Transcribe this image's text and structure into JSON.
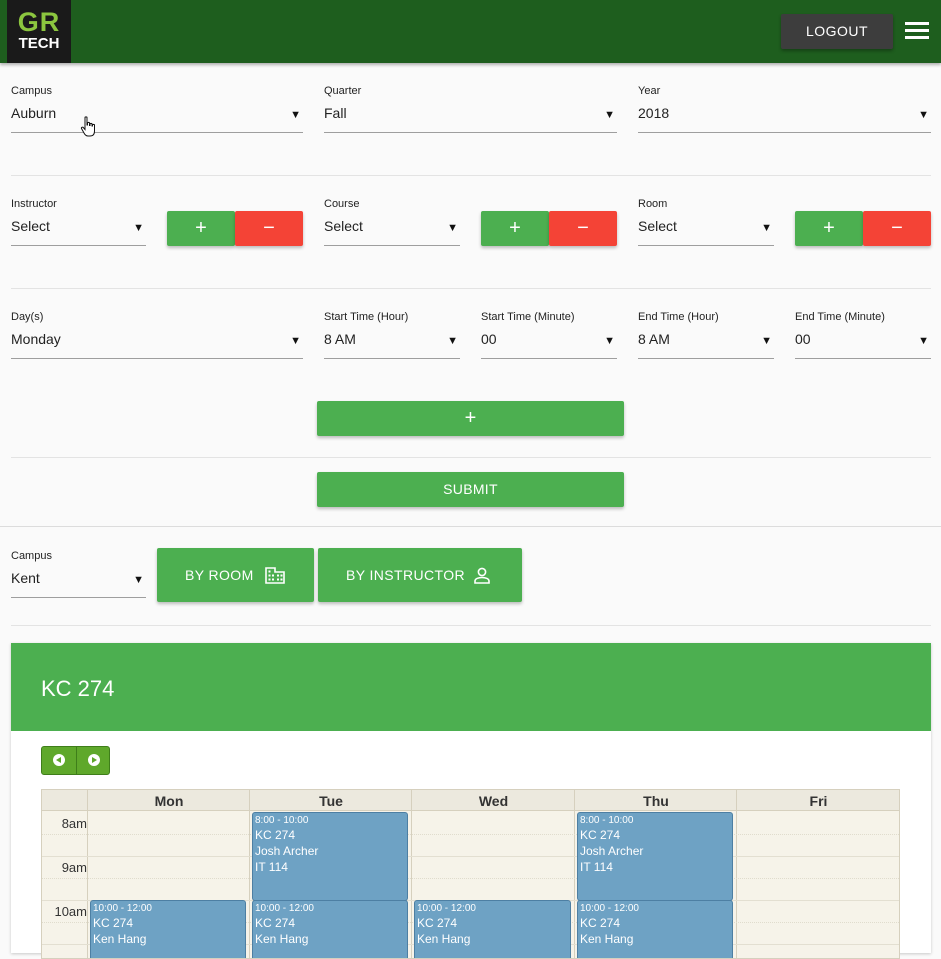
{
  "header": {
    "logo_top": "GR",
    "logo_bottom": "TECH",
    "logout_label": "LOGOUT"
  },
  "form": {
    "campus": {
      "label": "Campus",
      "value": "Auburn"
    },
    "quarter": {
      "label": "Quarter",
      "value": "Fall"
    },
    "year": {
      "label": "Year",
      "value": "2018"
    },
    "instructor": {
      "label": "Instructor",
      "value": "Select"
    },
    "course": {
      "label": "Course",
      "value": "Select"
    },
    "room": {
      "label": "Room",
      "value": "Select"
    },
    "days": {
      "label": "Day(s)",
      "value": "Monday"
    },
    "start_hour": {
      "label": "Start Time (Hour)",
      "value": "8 AM"
    },
    "start_minute": {
      "label": "Start Time (Minute)",
      "value": "00"
    },
    "end_hour": {
      "label": "End Time (Hour)",
      "value": "8 AM"
    },
    "end_minute": {
      "label": "End Time (Minute)",
      "value": "00"
    },
    "add_symbol": "+",
    "remove_symbol": "−",
    "add_time_label": "+",
    "submit_label": "SUBMIT"
  },
  "view": {
    "campus": {
      "label": "Campus",
      "value": "Kent"
    },
    "by_room_label": "BY ROOM",
    "by_instructor_label": "BY INSTRUCTOR"
  },
  "schedule": {
    "title": "KC 274",
    "days": [
      "Mon",
      "Tue",
      "Wed",
      "Thu",
      "Fri"
    ],
    "times": [
      "8am",
      "9am",
      "10am"
    ],
    "events": [
      {
        "time": "8:00 - 10:00",
        "room": "KC 274",
        "instructor": "Josh Archer",
        "course": "IT 114"
      },
      {
        "time": "8:00 - 10:00",
        "room": "KC 274",
        "instructor": "Josh Archer",
        "course": "IT 114"
      },
      {
        "time": "10:00 - 12:00",
        "room": "KC 274",
        "instructor": "Ken Hang"
      },
      {
        "time": "10:00 - 12:00",
        "room": "KC 274",
        "instructor": "Ken Hang"
      },
      {
        "time": "10:00 - 12:00",
        "room": "KC 274",
        "instructor": "Ken Hang"
      },
      {
        "time": "10:00 - 12:00",
        "room": "KC 274",
        "instructor": "Ken Hang"
      }
    ]
  },
  "colors": {
    "topbar": "#1e5e1e",
    "primary_green": "#4caf50",
    "danger_red": "#f44336",
    "event_blue": "#6ea2c4"
  }
}
